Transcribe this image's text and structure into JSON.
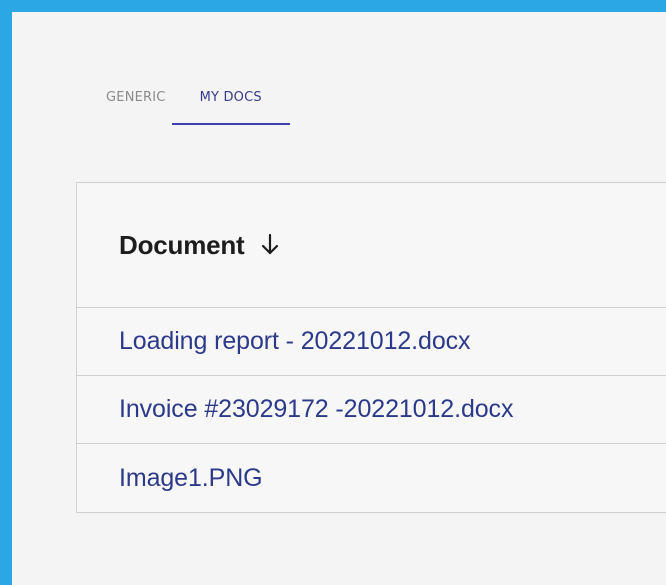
{
  "colors": {
    "frame_bg": "#2aa7e4",
    "panel_bg": "#f4f4f4",
    "tab_inactive": "#8a8a8a",
    "tab_active": "#3a3a8c",
    "tab_underline": "#3f3fb2",
    "link": "#2b3a8a",
    "border": "#cfcfcf"
  },
  "tabs": [
    {
      "label": "GENERIC",
      "active": false
    },
    {
      "label": "MY DOCS",
      "active": true
    }
  ],
  "table": {
    "header": {
      "label": "Document",
      "sort_icon": "arrow-down-icon"
    },
    "rows": [
      {
        "label": "Loading report - 20221012.docx"
      },
      {
        "label": "Invoice #23029172 -20221012.docx"
      },
      {
        "label": "Image1.PNG"
      }
    ]
  }
}
